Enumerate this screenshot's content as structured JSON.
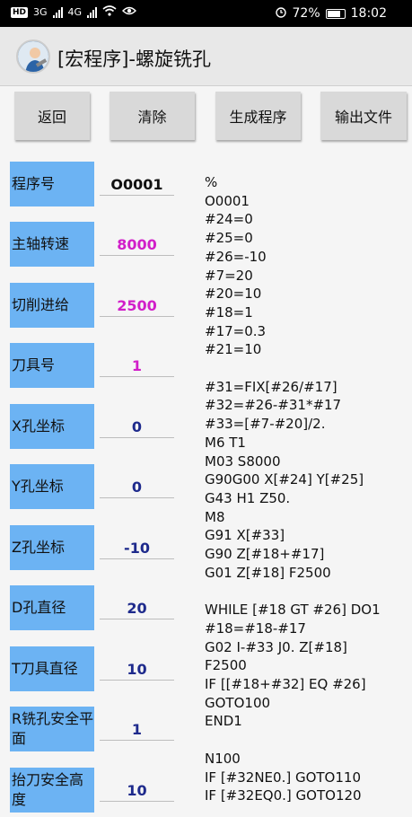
{
  "status_bar": {
    "hd": "HD",
    "net1": "3G",
    "net2": "4G",
    "battery_pct": "72%",
    "time": "18:02"
  },
  "app": {
    "title": "[宏程序]-螺旋铣孔"
  },
  "toolbar": {
    "back": "返回",
    "clear": "清除",
    "generate": "生成程序",
    "export": "输出文件"
  },
  "form": [
    {
      "label": "程序号",
      "value": "O0001"
    },
    {
      "label": "主轴转速",
      "value": "8000"
    },
    {
      "label": "切削进给",
      "value": "2500"
    },
    {
      "label": "刀具号",
      "value": "1"
    },
    {
      "label": "X孔坐标",
      "value": "0"
    },
    {
      "label": "Y孔坐标",
      "value": "0"
    },
    {
      "label": "Z孔坐标",
      "value": "-10"
    },
    {
      "label": "D孔直径",
      "value": "20"
    },
    {
      "label": "T刀具直径",
      "value": "10"
    },
    {
      "label": "R铣孔安全平面",
      "value": "1"
    },
    {
      "label": "抬刀安全高度",
      "value": "10"
    }
  ],
  "program_text": "%\nO0001\n#24=0\n#25=0\n#26=-10\n#7=20\n#20=10\n#18=1\n#17=0.3\n#21=10\n\n#31=FIX[#26/#17]\n#32=#26-#31*#17\n#33=[#7-#20]/2.\nM6 T1\nM03 S8000\nG90G00 X[#24] Y[#25]\nG43 H1 Z50.\nM8\nG91 X[#33]\nG90 Z[#18+#17]\nG01 Z[#18] F2500\n\nWHILE [#18 GT #26] DO1\n#18=#18-#17\nG02 I-#33 J0. Z[#18]\nF2500\nIF [[#18+#32] EQ #26]\nGOTO100\nEND1\n\nN100\nIF [#32NE0.] GOTO110\nIF [#32EQ0.] GOTO120"
}
